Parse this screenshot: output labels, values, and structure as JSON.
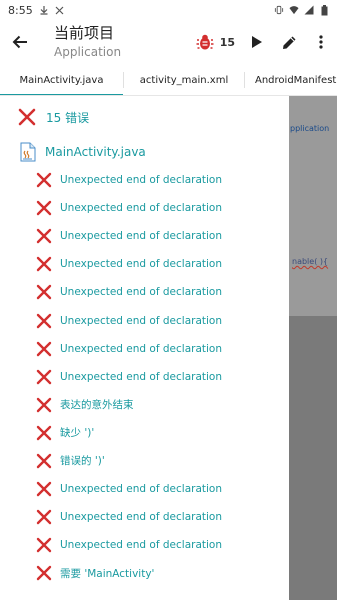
{
  "status_bar": {
    "time": "8:55",
    "left_icons": [
      "download-icon",
      "close-icon"
    ],
    "right_icons": [
      "vibrate-icon",
      "wifi-icon",
      "signal-icon",
      "battery-icon"
    ]
  },
  "toolbar": {
    "title": "当前项目",
    "subtitle": "Application",
    "bug_count": "15",
    "colors": {
      "bug": "#d32f2f",
      "accent": "#1a9aa0"
    }
  },
  "tabs": [
    {
      "label": "MainActivity.java",
      "active": true
    },
    {
      "label": "activity_main.xml",
      "active": false
    },
    {
      "label": "AndroidManifest",
      "active": false
    }
  ],
  "editor_peek": {
    "line1": "pplication",
    "line2": "nable( ){"
  },
  "errors": {
    "summary": "15 错误",
    "file": "MainActivity.java",
    "items": [
      "Unexpected end of declaration",
      "Unexpected end of declaration",
      "Unexpected end of declaration",
      "Unexpected end of declaration",
      "Unexpected end of declaration",
      "Unexpected end of declaration",
      "Unexpected end of declaration",
      "Unexpected end of declaration",
      "表达的意外结束",
      "缺少 ')'",
      "错误的 ')'",
      "Unexpected end of declaration",
      "Unexpected end of declaration",
      "Unexpected end of declaration",
      "需要 'MainActivity'"
    ]
  }
}
